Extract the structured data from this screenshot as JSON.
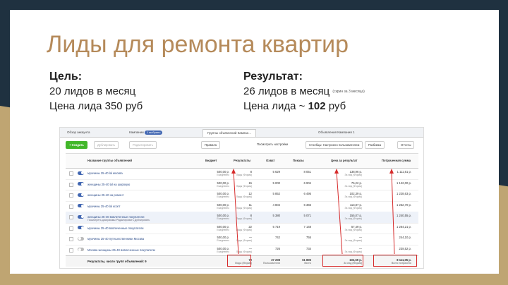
{
  "slide": {
    "title": "Лиды для ремонта квартир",
    "goal_label": "Цель:",
    "goal_leads": "20 лидов в месяц",
    "goal_price": "Цена лида 350 руб",
    "result_label": "Результат:",
    "result_leads": "26 лидов в месяц",
    "result_note": "(скрин за 3 месяца)",
    "result_price_prefix": "Цена лида ~ ",
    "result_price_value": "102",
    "result_price_suffix": " руб"
  },
  "ads": {
    "tabs": {
      "account": "Обзор аккаунта",
      "campaigns": "Кампании",
      "selected": "1 выбрано",
      "adsets": "Группы объявлений Кампан...",
      "ads": "Объявления Кампания 1"
    },
    "toolbar": {
      "create": "+ Создать",
      "duplicate": "Дублировать",
      "edit": "Редактировать",
      "rules": "Правила",
      "view_setup": "Посмотреть настройки",
      "columns": "Столбцы: Настроено пользователем",
      "breakdown": "Разбивка",
      "reports": "Отчеты"
    },
    "headers": {
      "name": "Название группы объявлений",
      "budget": "Бюджет",
      "results": "Результаты",
      "reach": "Охват",
      "impressions": "Показы",
      "cost": "Цена за результат",
      "spent": "Потраченная сумма"
    },
    "rows": [
      {
        "name": "мужчины 25-40 lal москва",
        "on": true,
        "budget": "500,00 р.",
        "budget_sub": "Ежедневно",
        "results": "8",
        "results_sub": "Лиды (Форма)",
        "reach": "5 629",
        "impressions": "8 051",
        "cost": "138,96 р.",
        "cost_sub": "За лид (Форма)",
        "spent": "1 111,61 р."
      },
      {
        "name": "женщины 25-40 lal на широкую",
        "on": true,
        "budget": "500,00 р.",
        "budget_sub": "Ежедневно",
        "results": "15",
        "results_sub": "Лиды (Форма)",
        "reach": "5 000",
        "impressions": "6 904",
        "cost": "75,22 р.",
        "cost_sub": "За лид (Форма)",
        "spent": "1 122,00 р."
      },
      {
        "name": "женщины 25-40 на ремонт",
        "on": true,
        "budget": "500,00 р.",
        "budget_sub": "Ежедневно",
        "results": "12",
        "results_sub": "Лиды (Форма)",
        "reach": "5 852",
        "impressions": "6 495",
        "cost": "102,39 р.",
        "cost_sub": "За лид (Форма)",
        "spent": "1 228,63 р."
      },
      {
        "name": "мужчины 25-40 lal ксопт",
        "on": true,
        "budget": "500,00 р.",
        "budget_sub": "Ежедневно",
        "results": "11",
        "results_sub": "Лиды (Форма)",
        "reach": "4 804",
        "impressions": "6 366",
        "cost": "113,87 р.",
        "cost_sub": "За лид (Форма)",
        "spent": "1 252,70 р."
      },
      {
        "name": "женщины 25-40 вовлеченные покупатели",
        "on": true,
        "highlight": true,
        "sub": "Посмотреть диаграммы  Редактировать  Дублировать",
        "budget": "500,00 р.",
        "budget_sub": "Ежедневно",
        "results": "8",
        "results_sub": "Лиды (Форма)",
        "reach": "5 380",
        "impressions": "5 071",
        "cost": "155,07 р.",
        "cost_sub": "За лид (Форма)",
        "spent": "1 240,55 р."
      },
      {
        "name": "мужчины 25-40 вовлеченные покупатели",
        "on": true,
        "budget": "500,00 р.",
        "budget_sub": "Ежедневно",
        "results": "22",
        "results_sub": "Лиды (Форма)",
        "reach": "5 719",
        "impressions": "7 148",
        "cost": "57,49 р.",
        "cost_sub": "За лид (Форма)",
        "spent": "1 264,21 р."
      },
      {
        "name": "мужчины 25-40 путешественники Москва",
        "on": false,
        "budget": "500,00 р.",
        "budget_sub": "Ежедневно",
        "results": "—",
        "results_sub": "Лиды (Форма)",
        "reach": "742",
        "impressions": "755",
        "cost": "—",
        "cost_sub": "За лид (Форма)",
        "spent": "244,10 р."
      },
      {
        "name": "Москва женщины 25-40 вовлеченные покупатели",
        "on": false,
        "budget": "500,00 р.",
        "budget_sub": "Ежедневно",
        "results": "—",
        "results_sub": "Лиды (Форма)",
        "reach": "726",
        "impressions": "734",
        "cost": "—",
        "cost_sub": "За лид (Форма)",
        "spent": "238,52 р."
      }
    ],
    "totals": {
      "label": "Результаты, число групп объявлений: 9",
      "results": "79",
      "results_sub": "Лиды (Форма)",
      "reach": "37 208",
      "reach_sub": "Пользователи",
      "impressions": "61 806",
      "impressions_sub": "Всего",
      "cost": "102,69 р.",
      "cost_sub": "За лид (Форма)",
      "spent": "8 111,05 р.",
      "spent_sub": "Всего потрачено"
    },
    "accent_color": "#d62b2b"
  }
}
